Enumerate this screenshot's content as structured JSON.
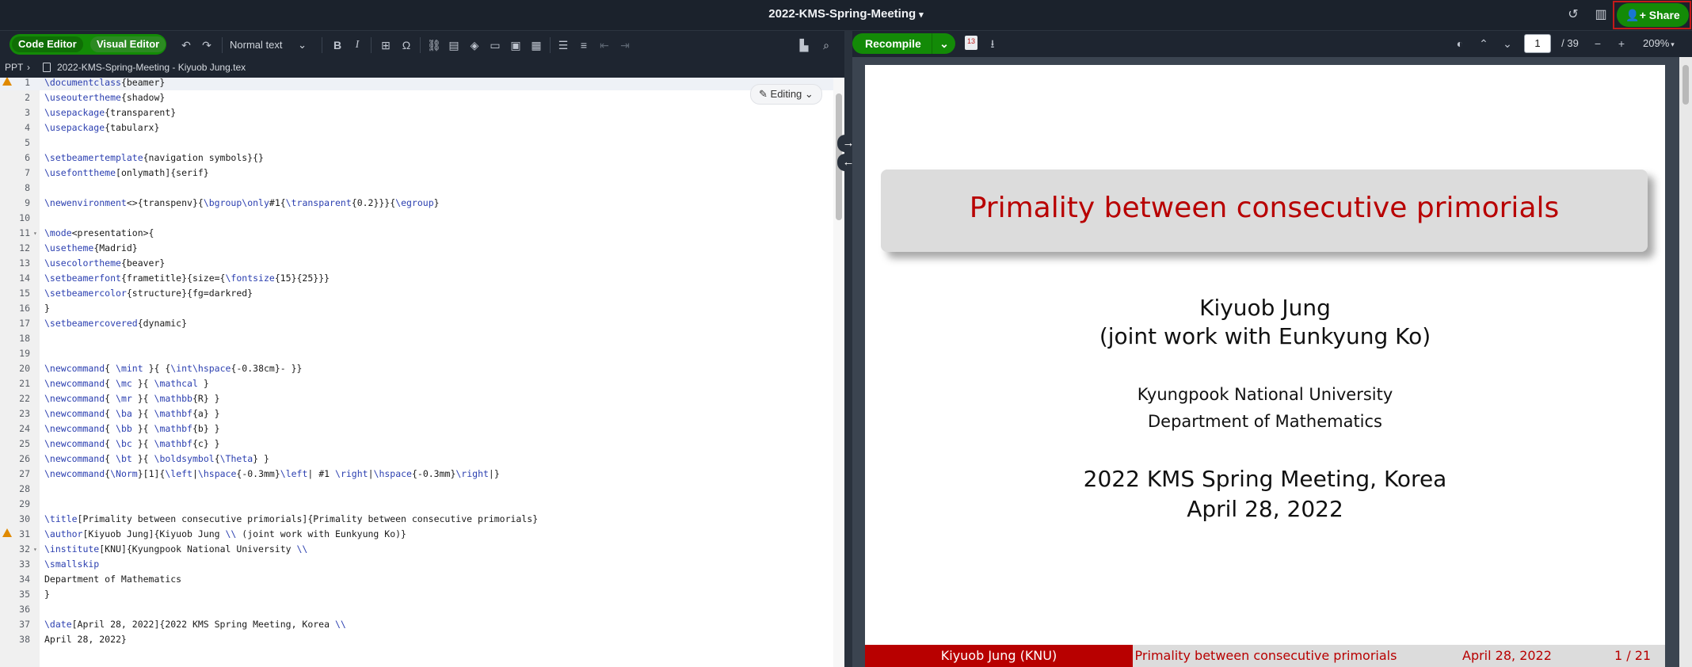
{
  "header": {
    "project_title": "2022-KMS-Spring-Meeting",
    "share_label": "Share"
  },
  "editor_toolbar": {
    "code_editor_label": "Code Editor",
    "visual_editor_label": "Visual Editor",
    "text_style": "Normal text",
    "bold_label": "B",
    "italic_label": "I"
  },
  "breadcrumb": {
    "folder": "PPT",
    "file": "2022-KMS-Spring-Meeting - Kiyuob Jung.tex"
  },
  "editing_mode": "Editing",
  "code_lines": [
    {
      "n": "1",
      "text": "\\documentclass{beamer}"
    },
    {
      "n": "2",
      "text": "\\useoutertheme{shadow}"
    },
    {
      "n": "3",
      "text": "\\usepackage{transparent}"
    },
    {
      "n": "4",
      "text": "\\usepackage{tabularx}"
    },
    {
      "n": "5",
      "text": ""
    },
    {
      "n": "6",
      "text": "\\setbeamertemplate{navigation symbols}{}"
    },
    {
      "n": "7",
      "text": "\\usefonttheme[onlymath]{serif}"
    },
    {
      "n": "8",
      "text": ""
    },
    {
      "n": "9",
      "text": "\\newenvironment<>{transpenv}{\\bgroup\\only#1{\\transparent{0.2}}}{\\egroup}"
    },
    {
      "n": "10",
      "text": ""
    },
    {
      "n": "11",
      "text": "\\mode<presentation>{"
    },
    {
      "n": "12",
      "text": "\\usetheme{Madrid}"
    },
    {
      "n": "13",
      "text": "\\usecolortheme{beaver}"
    },
    {
      "n": "14",
      "text": "\\setbeamerfont{frametitle}{size={\\fontsize{15}{25}}}"
    },
    {
      "n": "15",
      "text": "\\setbeamercolor{structure}{fg=darkred}"
    },
    {
      "n": "16",
      "text": "}"
    },
    {
      "n": "17",
      "text": "\\setbeamercovered{dynamic}"
    },
    {
      "n": "18",
      "text": ""
    },
    {
      "n": "19",
      "text": ""
    },
    {
      "n": "20",
      "text": "\\newcommand{ \\mint }{ {\\int\\hspace{-0.38cm}- }}"
    },
    {
      "n": "21",
      "text": "\\newcommand{ \\mc }{ \\mathcal }"
    },
    {
      "n": "22",
      "text": "\\newcommand{ \\mr }{ \\mathbb{R} }"
    },
    {
      "n": "23",
      "text": "\\newcommand{ \\ba }{ \\mathbf{a} }"
    },
    {
      "n": "24",
      "text": "\\newcommand{ \\bb }{ \\mathbf{b} }"
    },
    {
      "n": "25",
      "text": "\\newcommand{ \\bc }{ \\mathbf{c} }"
    },
    {
      "n": "26",
      "text": "\\newcommand{ \\bt }{ \\boldsymbol{\\Theta} }"
    },
    {
      "n": "27",
      "text": "\\newcommand{\\Norm}[1]{\\left|\\hspace{-0.3mm}\\left| #1 \\right|\\hspace{-0.3mm}\\right|}"
    },
    {
      "n": "28",
      "text": ""
    },
    {
      "n": "29",
      "text": ""
    },
    {
      "n": "30",
      "text": "\\title[Primality between consecutive primorials]{Primality between consecutive primorials}"
    },
    {
      "n": "31",
      "text": "\\author[Kiyuob Jung]{Kiyuob Jung \\\\ (joint work with Eunkyung Ko)}"
    },
    {
      "n": "32",
      "text": "\\institute[KNU]{Kyungpook National University \\\\"
    },
    {
      "n": "33",
      "text": "\\smallskip"
    },
    {
      "n": "34",
      "text": "Department of Mathematics"
    },
    {
      "n": "35",
      "text": "}"
    },
    {
      "n": "36",
      "text": ""
    },
    {
      "n": "37",
      "text": "\\date[April 28, 2022]{2022 KMS Spring Meeting, Korea \\\\"
    },
    {
      "n": "38",
      "text": "April 28, 2022}"
    }
  ],
  "pdf_toolbar": {
    "recompile_label": "Recompile",
    "badge_count": "13",
    "current_page": "1",
    "total_pages": "/ 39",
    "zoom": "209%"
  },
  "slide": {
    "title": "Primality between consecutive primorials",
    "author": "Kiyuob Jung",
    "coauthor": "(joint work with Eunkyung Ko)",
    "institute": "Kyungpook National University",
    "department": "Department of Mathematics",
    "event": "2022 KMS Spring Meeting, Korea",
    "date": "April 28, 2022",
    "footer_author": "Kiyuob Jung  (KNU)",
    "footer_title": "Primality between consecutive primorials",
    "footer_date": "April 28, 2022",
    "footer_page": "1 / 21"
  }
}
